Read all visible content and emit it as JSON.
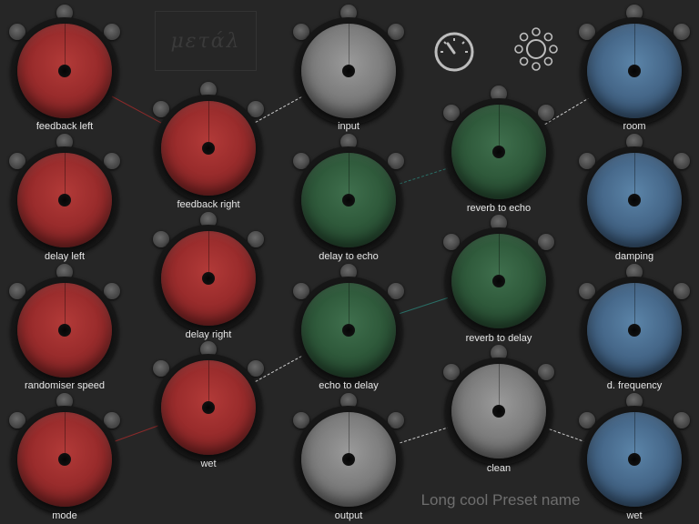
{
  "logo": {
    "text": "μετάλ"
  },
  "icons": {
    "meter": "gauge-icon",
    "settings": "gear-flower-icon"
  },
  "preset": {
    "name": "Long cool Preset name"
  },
  "colors": {
    "red": "#9a2c2c",
    "green": "#2f5a3b",
    "blue": "#46688a",
    "gray": "#7e7e7e",
    "connector_red": "#8a2a2a",
    "connector_white": "#cfcfcf",
    "connector_teal": "#2a6e66"
  },
  "knobs": [
    {
      "id": "feedback-left",
      "label": "feedback left",
      "color": "red"
    },
    {
      "id": "feedback-right",
      "label": "feedback right",
      "color": "red"
    },
    {
      "id": "delay-left",
      "label": "delay left",
      "color": "red"
    },
    {
      "id": "delay-right",
      "label": "delay right",
      "color": "red"
    },
    {
      "id": "randomiser-speed",
      "label": "randomiser speed",
      "color": "red"
    },
    {
      "id": "wet-red",
      "label": "wet",
      "color": "red"
    },
    {
      "id": "mode",
      "label": "mode",
      "color": "red"
    },
    {
      "id": "input",
      "label": "input",
      "color": "gray"
    },
    {
      "id": "delay-to-echo",
      "label": "delay to echo",
      "color": "green"
    },
    {
      "id": "echo-to-delay",
      "label": "echo to delay",
      "color": "green"
    },
    {
      "id": "output",
      "label": "output",
      "color": "gray"
    },
    {
      "id": "reverb-to-echo",
      "label": "reverb to echo",
      "color": "green"
    },
    {
      "id": "reverb-to-delay",
      "label": "reverb to delay",
      "color": "green"
    },
    {
      "id": "clean",
      "label": "clean",
      "color": "gray"
    },
    {
      "id": "room",
      "label": "room",
      "color": "blue"
    },
    {
      "id": "damping",
      "label": "damping",
      "color": "blue"
    },
    {
      "id": "d-frequency",
      "label": "d. frequency",
      "color": "blue"
    },
    {
      "id": "wet-blue",
      "label": "wet",
      "color": "blue"
    }
  ]
}
